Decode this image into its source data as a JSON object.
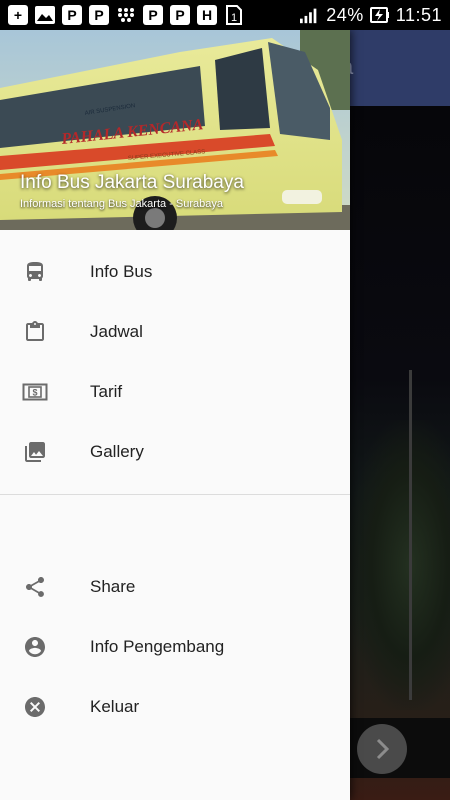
{
  "status_bar": {
    "battery_percent": "24%",
    "time": "11:51",
    "notification_icons": [
      "add-box-icon",
      "image-icon",
      "parking-icon",
      "parking-icon",
      "blackberry-icon",
      "parking-icon",
      "parking-icon",
      "h-icon",
      "sim-1-icon"
    ]
  },
  "app": {
    "toolbar_title_fragment": "ya"
  },
  "drawer": {
    "header": {
      "title": "Info Bus Jakarta Surabaya",
      "subtitle": "Informasi tentang Bus Jakarta - Surabaya",
      "image_text": {
        "bus_brand": "PAHALA KENCANA",
        "bus_class": "SUPER EXECUTIVE CLASS",
        "side_text": "AIR SUSPENSION"
      }
    },
    "primary_items": [
      {
        "label": "Info Bus",
        "icon": "bus-icon"
      },
      {
        "label": "Jadwal",
        "icon": "clipboard-icon"
      },
      {
        "label": "Tarif",
        "icon": "money-icon"
      },
      {
        "label": "Gallery",
        "icon": "photo-library-icon"
      }
    ],
    "secondary_items": [
      {
        "label": "Share",
        "icon": "share-icon"
      },
      {
        "label": "Info Pengembang",
        "icon": "account-circle-icon"
      },
      {
        "label": "Keluar",
        "icon": "cancel-icon"
      }
    ]
  },
  "colors": {
    "drawer_bg": "#fafafa",
    "icon_color": "#6b6b6b",
    "toolbar": "#2f3c68",
    "text_primary": "#222222"
  }
}
